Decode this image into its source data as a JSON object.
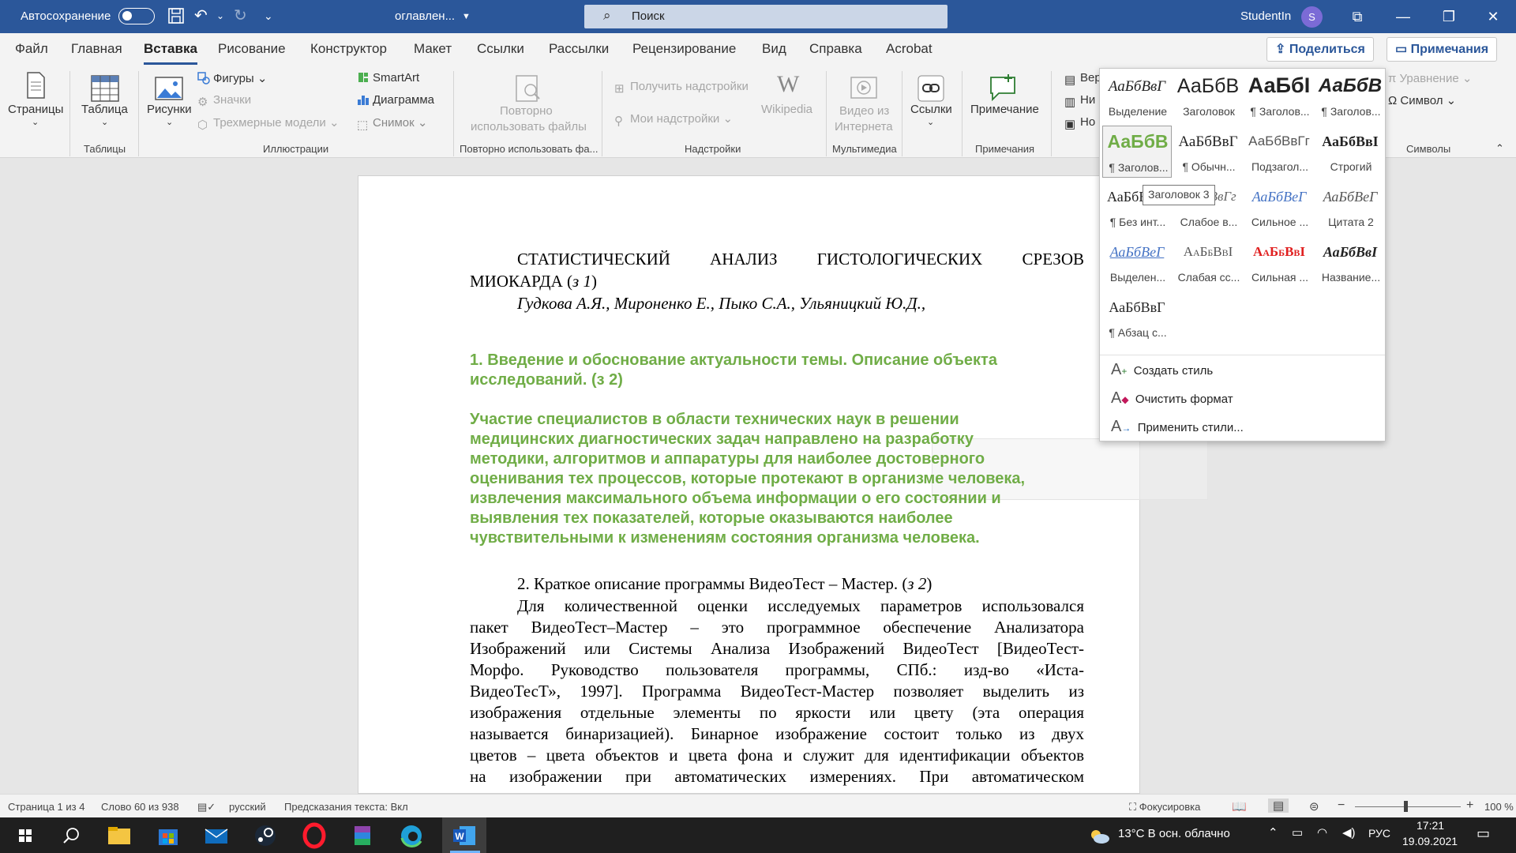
{
  "titlebar": {
    "autosave": "Автосохранение",
    "doc": "оглавлен...",
    "search": "Поиск",
    "user": "StudentIn",
    "avatar": "S"
  },
  "menubar": {
    "items": [
      "Файл",
      "Главная",
      "Вставка",
      "Рисование",
      "Конструктор",
      "Макет",
      "Ссылки",
      "Рассылки",
      "Рецензирование",
      "Вид",
      "Справка",
      "Acrobat"
    ],
    "share": "Поделиться",
    "comments": "Примечания"
  },
  "ribbon": {
    "pages": "Страницы",
    "table": "Таблица",
    "tables_group": "Таблицы",
    "pictures": "Рисунки",
    "shapes": "Фигуры",
    "icons": "Значки",
    "models3d": "Трехмерные модели",
    "smartart": "SmartArt",
    "chart": "Диаграмма",
    "snapshot": "Снимок",
    "illustrations_group": "Иллюстрации",
    "reuse1": "Повторно",
    "reuse2": "использовать файлы",
    "reuse_group": "Повторно использовать фа...",
    "get_addins": "Получить надстройки",
    "my_addins": "Мои надстройки",
    "wikipedia": "Wikipedia",
    "addins_group": "Надстройки",
    "video1": "Видео из",
    "video2": "Интернета",
    "media_group": "Мультимедиа",
    "links": "Ссылки",
    "comment": "Примечание",
    "comments_group": "Примечания",
    "header1": "Вер",
    "header2": "Ни",
    "header3": "Но",
    "equation": "Уравнение",
    "symbol": "Символ",
    "symbols_group": "Символы"
  },
  "document": {
    "title_line1": "СТАТИСТИЧЕСКИЙ АНАЛИЗ ГИСТОЛОГИЧЕСКИХ СРЕЗОВ",
    "title_line2_a": "МИОКАРДА (",
    "title_line2_b": "з 1",
    "title_line2_c": ")",
    "authors": "Гудкова А.Я., Мироненко Е., Пыко С.А., Ульяницкий Ю.Д.,",
    "h1_line1": "1. Введение и обоснование актуальности темы. Описание объекта",
    "h1_line2": "исследований. (з 2)",
    "para_green": [
      "Участие специалистов в области технических наук в решении",
      "медицинских диагностических задач направлено на разработку",
      "методики, алгоритмов и аппаратуры для наиболее достоверного",
      "оценивания тех процессов, которые протекают в организме человека,",
      "извлечения максимального объема информации о его состоянии и",
      "выявления тех показателей, которые оказываются наиболее",
      "чувствительными к изменениям состояния организма человека."
    ],
    "h2_a": "2. Краткое описание программы ВидеоТест – Мастер. (",
    "h2_b": "з 2",
    "h2_c": ")",
    "body": [
      "Для количественной оценки исследуемых параметров использовался",
      "пакет ВидеоТест–Мастер – это программное обеспечение Анализатора",
      "Изображений или Системы Анализа Изображений ВидеоТест [ВидеоТест-",
      "Морфо. Руководство пользователя программы, СПб.: изд-во «Иста-",
      "ВидеоТесТ», 1997]. Программа ВидеоТест-Мастер позволяет выделить из",
      "изображения отдельные элементы по яркости или цвету (эта операция",
      "называется бинаризацией). Бинарное изображение состоит только из двух",
      "цветов – цвета объектов и цвета фона и служит для идентификации объектов",
      "на изображении при автоматических измерениях. При автоматическом"
    ]
  },
  "styles": [
    {
      "preview": "АаБбВвГ",
      "name": "Выделение"
    },
    {
      "preview": "АаБбВ",
      "name": "Заголовок"
    },
    {
      "preview": "АаБбI",
      "name": "¶ Заголов..."
    },
    {
      "preview": "АаБбВ",
      "name": "¶ Заголов..."
    },
    {
      "preview": "АаБбВ",
      "name": "¶ Заголов..."
    },
    {
      "preview": "АаБбВвГ",
      "name": "¶ Обычн..."
    },
    {
      "preview": "АаБбВвГг",
      "name": "Подзагол..."
    },
    {
      "preview": "АаБбВвІ",
      "name": "Строгий"
    },
    {
      "preview": "АаБбВвГг",
      "name": "¶ Без инт..."
    },
    {
      "preview": "АаБбВвГг",
      "name": "Слабое в..."
    },
    {
      "preview": "АаБбВеГ",
      "name": "Сильное ..."
    },
    {
      "preview": "АаБбВеГ",
      "name": "Цитата 2"
    },
    {
      "preview": "АаБбВеГ",
      "name": "Выделен..."
    },
    {
      "preview": "АаБбВвІ",
      "name": "Слабая сс..."
    },
    {
      "preview": "АаБбВвІ",
      "name": "Сильная ..."
    },
    {
      "preview": "АаБбВвІ",
      "name": "Название..."
    },
    {
      "preview": "АаБбВвГ",
      "name": "¶ Абзац с..."
    }
  ],
  "tooltip": "Заголовок 3",
  "gallery_menu": {
    "create": "Создать стиль",
    "clear": "Очистить формат",
    "apply": "Применить стили..."
  },
  "status": {
    "page": "Страница 1 из 4",
    "words": "Слово 60 из 938",
    "lang": "русский",
    "predict": "Предсказания текста: Вкл",
    "focus": "Фокусировка",
    "zoom": "100 %"
  },
  "taskbar": {
    "weather": "13°C  В осн. облачно",
    "lang": "РУС",
    "time": "17:21",
    "date": "19.09.2021"
  }
}
